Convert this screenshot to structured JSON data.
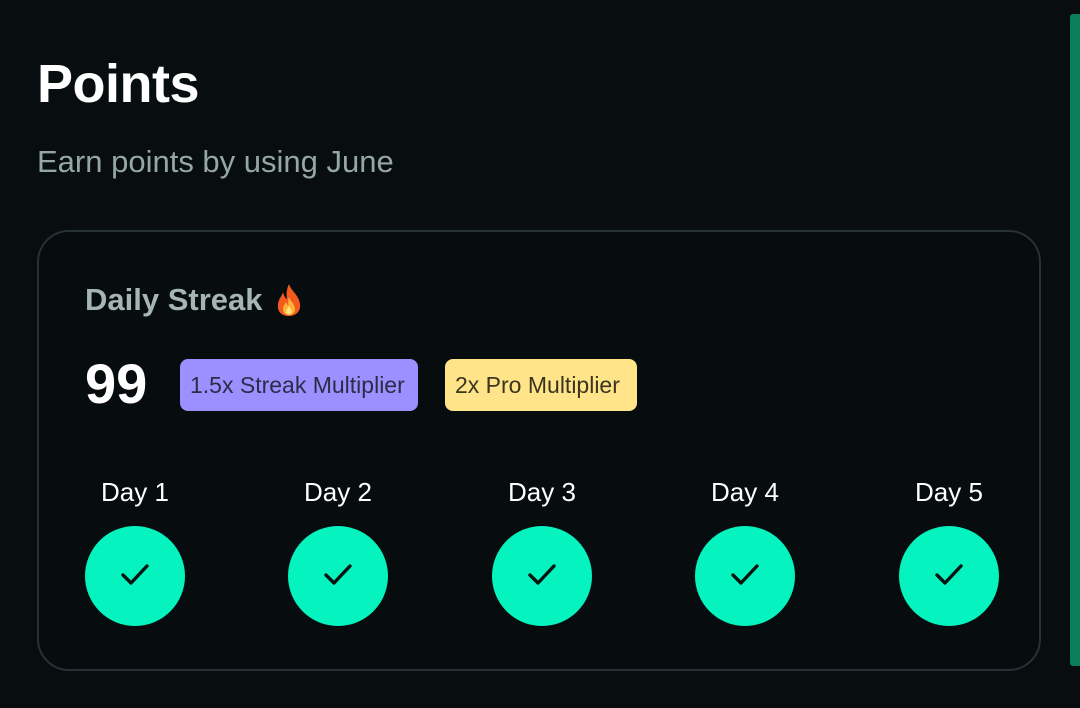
{
  "page": {
    "title": "Points",
    "subtitle": "Earn points by using June"
  },
  "streak": {
    "title": "Daily Streak",
    "title_icon": "fire-icon",
    "count": "99",
    "badges": [
      {
        "label": "1.5x Streak Multiplier",
        "color": "#9b90ff"
      },
      {
        "label": "2x Pro Multiplier",
        "color": "#ffe48a"
      }
    ],
    "days": [
      {
        "label": "Day 1",
        "completed": true,
        "icon": "checkmark-icon"
      },
      {
        "label": "Day 2",
        "completed": true,
        "icon": "checkmark-icon"
      },
      {
        "label": "Day 3",
        "completed": true,
        "icon": "checkmark-icon"
      },
      {
        "label": "Day 4",
        "completed": true,
        "icon": "checkmark-icon"
      },
      {
        "label": "Day 5",
        "completed": true,
        "icon": "checkmark-icon"
      }
    ]
  },
  "colors": {
    "background": "#080d10",
    "accent": "#05f3be",
    "muted_text": "#95a7a4"
  }
}
